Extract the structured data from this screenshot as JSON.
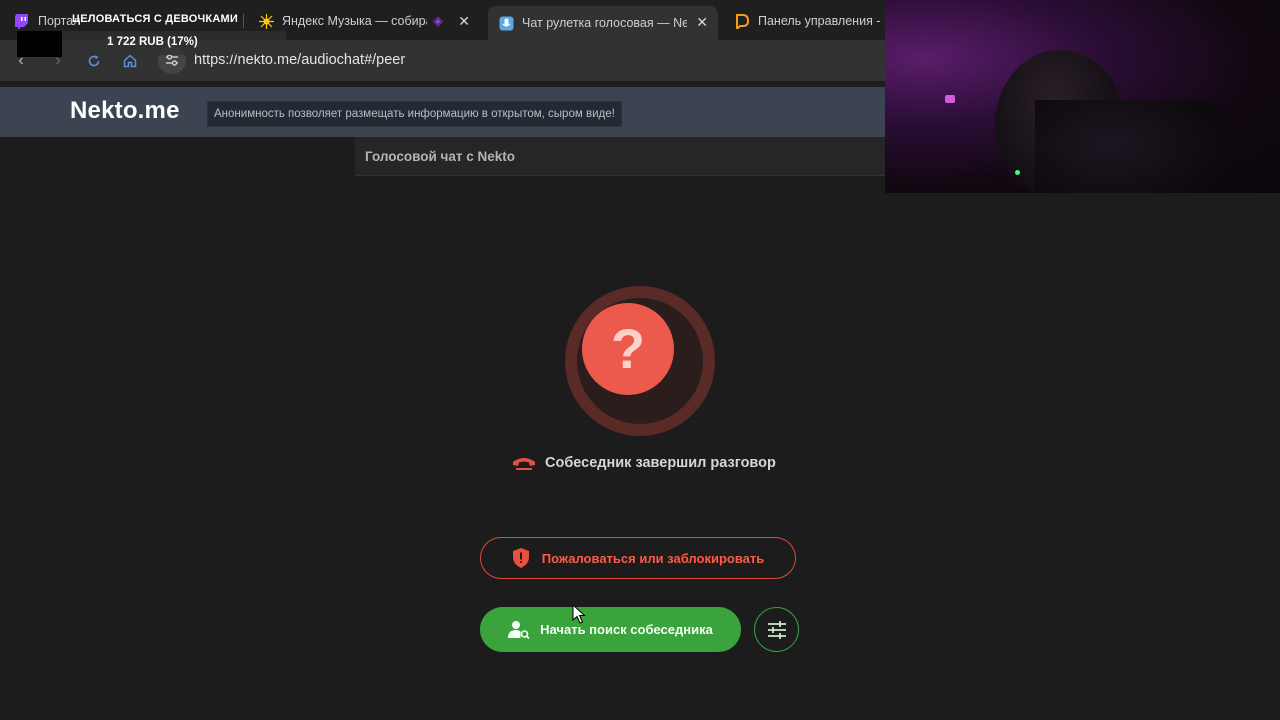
{
  "browser": {
    "tabs": [
      {
        "title": "Портал",
        "active": false,
        "favicon": "twitch-icon"
      },
      {
        "title": "Яндекс Музыка — собира",
        "active": false,
        "favicon": "yandex-music-icon"
      },
      {
        "title": "Чат рулетка голосовая — Nek",
        "active": true,
        "favicon": "nekto-mic-icon"
      },
      {
        "title": "Панель управления - D",
        "active": false,
        "favicon": "donationalerts-icon"
      }
    ],
    "url": "https://nekto.me/audiochat#/peer"
  },
  "stream_overlay": {
    "banner": "ЦЕЛОВАТЬСЯ С ДЕВОЧКАМИ",
    "donation_goal": "1 722 RUB (17%)"
  },
  "site": {
    "logo": "Nekto.me",
    "slogan": "Анонимность позволяет размещать информацию в открытом, сыром виде!",
    "chat_title": "Голосовой чат с Nekto"
  },
  "call": {
    "avatar_symbol": "?",
    "status_text": "Собеседник завершил разговор",
    "report_button": "Пожаловаться или заблокировать",
    "search_button": "Начать поиск собеседника"
  },
  "colors": {
    "accent_red": "#ec5a4d",
    "accent_green": "#3aa33b",
    "header_bg": "#3b4450"
  }
}
